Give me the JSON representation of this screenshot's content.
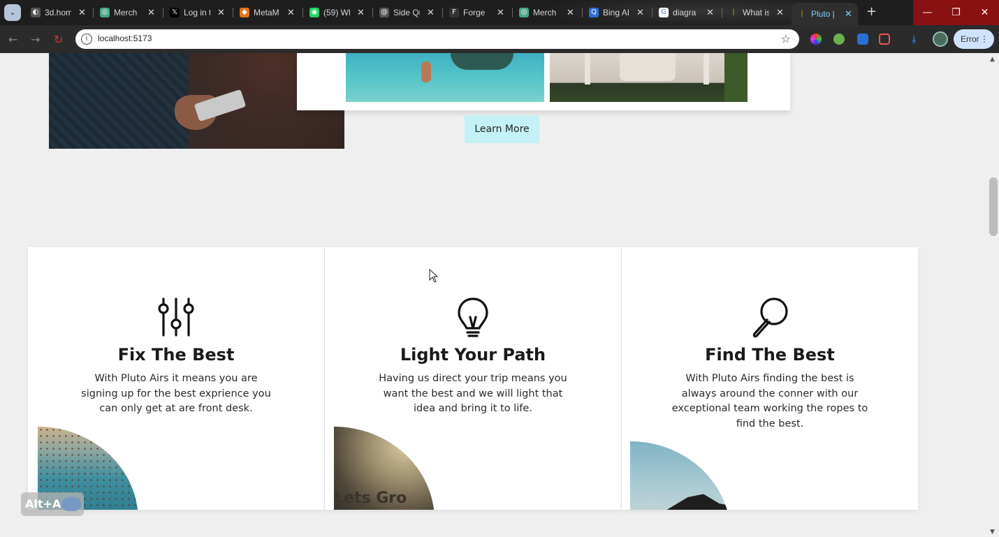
{
  "browser": {
    "tabs": [
      {
        "title": "3d.hom",
        "color": "#7a7a7a",
        "glyph": "◐"
      },
      {
        "title": "Merch",
        "color": "#4aa88a",
        "glyph": "◎"
      },
      {
        "title": "Log in t",
        "color": "#000000",
        "glyph": "𝕏"
      },
      {
        "title": "MetaM",
        "color": "#e2761b",
        "glyph": "◆"
      },
      {
        "title": "(59) Wh",
        "color": "#25d366",
        "glyph": "◉"
      },
      {
        "title": "Side Qu",
        "color": "#555555",
        "glyph": "@"
      },
      {
        "title": "Forge",
        "color": "#333333",
        "glyph": "F"
      },
      {
        "title": "Merch",
        "color": "#4aa88a",
        "glyph": "◎"
      },
      {
        "title": "Bing AI",
        "color": "#2a6fd6",
        "glyph": "Q"
      },
      {
        "title": "diagra",
        "color": "#ffffff",
        "glyph": "G"
      },
      {
        "title": "What is",
        "color": "#d4a017",
        "glyph": "|"
      },
      {
        "title": "Pluto |",
        "color": "#d4a017",
        "glyph": "|"
      }
    ],
    "active_tab_index": 11,
    "url": "localhost:5173",
    "error_label": "Error"
  },
  "page": {
    "learn_more_label": "Learn More",
    "features": [
      {
        "icon": "sliders-icon",
        "title": "Fix The Best",
        "text": "With Pluto Airs it means you are signing up for the best exprience you can only get at are front desk."
      },
      {
        "icon": "lightbulb-icon",
        "title": "Light Your Path",
        "text": "Having us direct your trip means you want the best and we will light that idea and bring it to life.",
        "image_text": "Lets Gro"
      },
      {
        "icon": "magnifier-icon",
        "title": "Find The Best",
        "text": "With Pluto Airs finding the best is always around the conner with our exceptional team working the ropes to find the best."
      }
    ],
    "alt_widget_label": "Alt+A"
  }
}
